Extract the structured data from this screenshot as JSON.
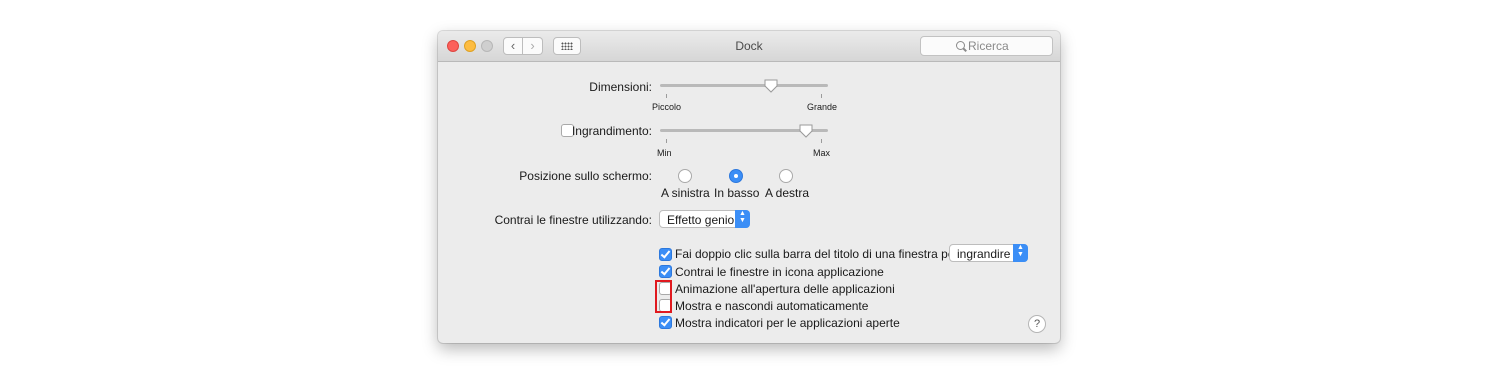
{
  "window": {
    "title": "Dock"
  },
  "toolbar": {
    "back_glyph": "‹",
    "forward_glyph": "›",
    "grid_icon": "grid-icon",
    "search_placeholder": "Ricerca"
  },
  "dimensioni": {
    "label": "Dimensioni:",
    "min_label": "Piccolo",
    "max_label": "Grande",
    "value_fraction": 0.66
  },
  "ingrandimento": {
    "label": "Ingrandimento:",
    "checked": false,
    "min_label": "Min",
    "max_label": "Max",
    "value_fraction": 0.87
  },
  "posizione": {
    "label": "Posizione sullo schermo:",
    "options": [
      {
        "label": "A sinistra",
        "selected": false
      },
      {
        "label": "In basso",
        "selected": true
      },
      {
        "label": "A destra",
        "selected": false
      }
    ]
  },
  "contrai": {
    "label": "Contrai le finestre utilizzando:",
    "value": "Effetto genio"
  },
  "checkboxes": [
    {
      "label": "Fai doppio clic sulla barra del titolo di una finestra per",
      "checked": true,
      "popup_value": "ingrandire"
    },
    {
      "label": "Contrai le finestre in icona applicazione",
      "checked": true
    },
    {
      "label": "Animazione all'apertura delle applicazioni",
      "checked": false
    },
    {
      "label": "Mostra e nascondi automaticamente",
      "checked": false
    },
    {
      "label": "Mostra indicatori per le applicazioni aperte",
      "checked": true
    }
  ],
  "help": {
    "glyph": "?"
  },
  "colors": {
    "accent": "#3b8ef6",
    "highlight": "#e0191f"
  }
}
